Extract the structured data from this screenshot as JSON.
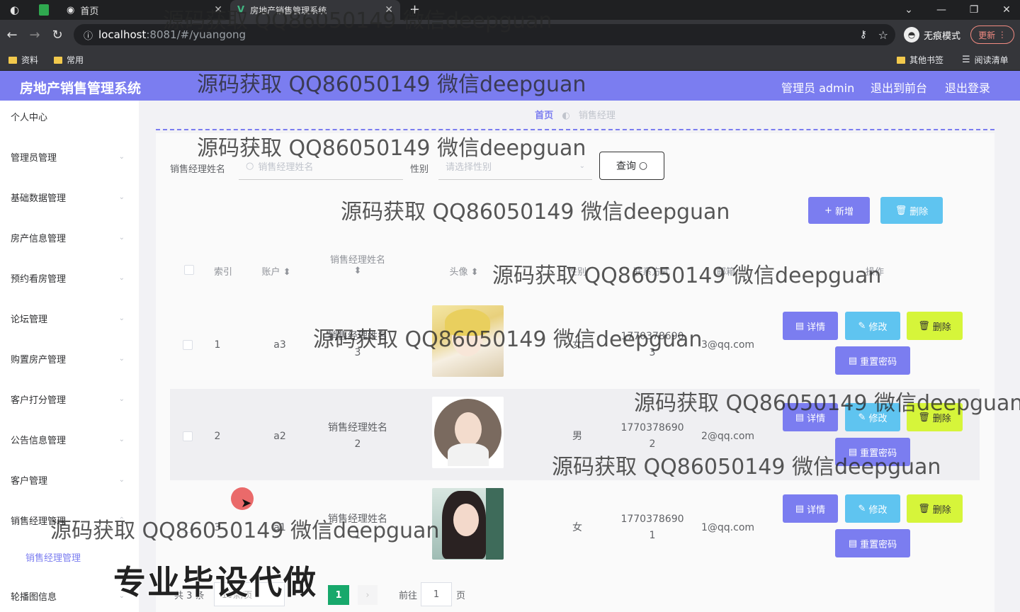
{
  "browser": {
    "tabs": [
      {
        "label": "首页"
      },
      {
        "label": "房地产销售管理系统"
      }
    ],
    "url_host": "localhost",
    "url_path": ":8081/#/yuangong",
    "incognito_label": "无痕模式",
    "update_label": "更新",
    "bookmarks": [
      "资料",
      "常用"
    ],
    "bookmarks_right": [
      "其他书签",
      "阅读清单"
    ]
  },
  "header": {
    "title": "房地产销售管理系统",
    "admin_label": "管理员 admin",
    "to_front": "退出到前台",
    "logout": "退出登录"
  },
  "sidebar": {
    "items": [
      {
        "label": "个人中心"
      },
      {
        "label": "管理员管理"
      },
      {
        "label": "基础数据管理"
      },
      {
        "label": "房产信息管理"
      },
      {
        "label": "预约看房管理"
      },
      {
        "label": "论坛管理"
      },
      {
        "label": "购置房产管理"
      },
      {
        "label": "客户打分管理"
      },
      {
        "label": "公告信息管理"
      },
      {
        "label": "客户管理"
      },
      {
        "label": "销售经理管理"
      },
      {
        "label": "销售经理管理"
      },
      {
        "label": "轮播图信息"
      }
    ]
  },
  "breadcrumb": {
    "home": "首页",
    "current": "销售经理"
  },
  "search": {
    "name_label": "销售经理姓名",
    "name_placeholder": "销售经理姓名",
    "gender_label": "性别",
    "gender_placeholder": "请选择性别",
    "query_button": "查询"
  },
  "toolbar": {
    "add": "新增",
    "delete": "删除"
  },
  "table": {
    "headers": [
      "索引",
      "账户",
      "销售经理姓名",
      "头像",
      "性别",
      "联系方式",
      "邮箱",
      "操作"
    ],
    "rows": [
      {
        "index": "1",
        "account": "a3",
        "name": "销售经理姓名",
        "name_num": "3",
        "gender": "女",
        "phone": "1770378690",
        "phone_num": "3",
        "email": "3@qq.com"
      },
      {
        "index": "2",
        "account": "a2",
        "name": "销售经理姓名",
        "name_num": "2",
        "gender": "男",
        "phone": "1770378690",
        "phone_num": "2",
        "email": "2@qq.com"
      },
      {
        "index": "3",
        "account": "a1",
        "name": "销售经理姓名",
        "name_num": "1",
        "gender": "女",
        "phone": "1770378690",
        "phone_num": "1",
        "email": "1@qq.com"
      }
    ],
    "actions": {
      "detail": "详情",
      "edit": "修改",
      "delete": "删除",
      "reset": "重置密码"
    }
  },
  "pager": {
    "total": "共 3 条",
    "page_size": "10条/页",
    "current": "1",
    "goto": "前往",
    "goto_value": "1",
    "page_suffix": "页"
  },
  "watermark": "源码获取 QQ86050149 微信deepguan",
  "overlay_text": "专业毕设代做",
  "colors": {
    "primary": "#7b7df0",
    "info": "#5fc4f0",
    "lime": "#d6f53a",
    "pager_active": "#17a86b"
  }
}
